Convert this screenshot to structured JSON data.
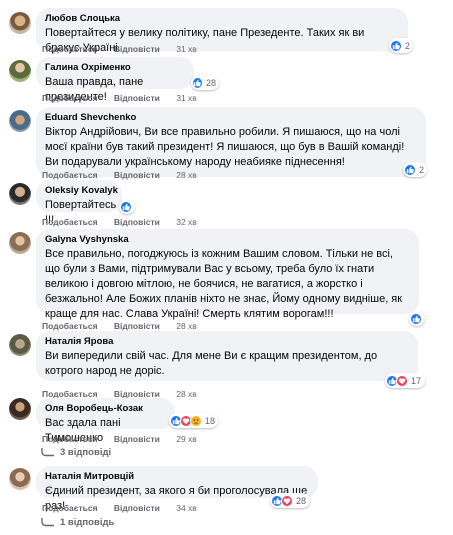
{
  "labels": {
    "like": "Подобається",
    "reply": "Відповісти"
  },
  "colors": {
    "bubble": "#f0f2f5",
    "like_blue": "#1877f2",
    "love_red": "#f33e58",
    "sad_yellow": "#f7b125",
    "meta_gray": "#65676b"
  },
  "comments": [
    {
      "author": "Любов Слоцька",
      "text": "Повертайтеся у велику політику, пане Презеденте. Таких як ви бракує Україні.",
      "time": "31 хв",
      "reaction_icons": [
        "like-icon"
      ],
      "reaction_count": "2"
    },
    {
      "author": "Галина Охріменко",
      "text": "Ваша правда, пане президенте!",
      "time": "31 хв",
      "reaction_icons": [
        "like-icon"
      ],
      "reaction_count": "28"
    },
    {
      "author": "Eduard Shevchenko",
      "text": "Віктор Андрійович, Ви все правильно робили. Я пишаюся, що на чолі моєї країни був такий президент! Я пишаюся, що був в Вашій команді! Ви подарували українському народу неабияке піднесення!",
      "time": "28 хв",
      "reaction_icons": [
        "like-icon"
      ],
      "reaction_count": "2"
    },
    {
      "author": "Oleksiy Kovalyk",
      "text": "Повертайтесь !!!",
      "time": "32 хв",
      "reaction_icons": [
        "like-icon"
      ],
      "reaction_count": ""
    },
    {
      "author": "Galyna Vyshynska",
      "text": "Все правильно, погоджуюсь із кожним Вашим словом. Тільки не всі, що були з Вами, підтримували Вас у всьому, треба було їх гнати великою і довгою мітлою, не боячися, не вагатися, а жорстко і безжально! Але Божих планів ніхто не знає, Йому одному видніше, як краще для нас. Слава Україні! Смерть клятим ворогам!!!",
      "time": "28 хв",
      "reaction_icons": [
        "like-icon"
      ],
      "reaction_count": ""
    },
    {
      "author": "Наталія Ярова",
      "text": "Ви випередили свій час. Для мене Ви є кращим президентом, до котрого народ не доріс.",
      "time": "28 хв",
      "reaction_icons": [
        "like-icon",
        "love-icon"
      ],
      "reaction_count": "17"
    },
    {
      "author": "Оля Воробець-Козак",
      "text": "Вас здала пані Тимошенко",
      "time": "29 хв",
      "reaction_icons": [
        "like-icon",
        "love-icon",
        "sad-icon"
      ],
      "reaction_count": "18",
      "replies_label": "3 відповіді"
    },
    {
      "author": "Наталія Митровцій",
      "text": "Єдиний президент, за якого я би проголосувала ще раз!",
      "time": "34 хв",
      "reaction_icons": [
        "like-icon",
        "love-icon"
      ],
      "reaction_count": "28",
      "replies_label": "1 відповідь"
    }
  ]
}
